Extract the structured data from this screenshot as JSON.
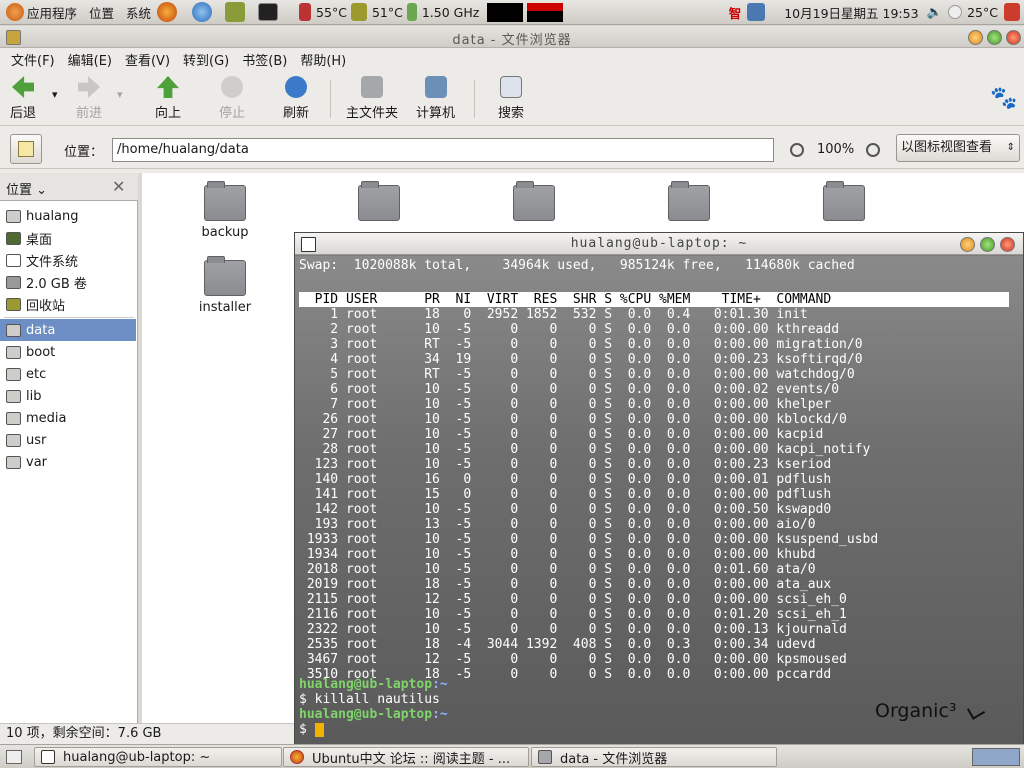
{
  "top_panel": {
    "apps_menu": "应用程序",
    "places_menu": "位置",
    "system_menu": "系统",
    "cpu_temp1": "55°C",
    "cpu_temp2": "51°C",
    "cpu_freq": "1.50 GHz",
    "clock": "10月19日星期五  19:53",
    "weather": "25°C",
    "input_method": "智"
  },
  "nautilus": {
    "title": "data - 文件浏览器",
    "menu": [
      "文件(F)",
      "编辑(E)",
      "查看(V)",
      "转到(G)",
      "书签(B)",
      "帮助(H)"
    ],
    "toolbar": {
      "back": "后退",
      "forward": "前进",
      "up": "向上",
      "stop": "停止",
      "refresh": "刷新",
      "home": "主文件夹",
      "computer": "计算机",
      "search": "搜索"
    },
    "location_label": "位置：",
    "location_path": "/home/hualang/data",
    "zoom": "100%",
    "view_mode": "以图标视图查看",
    "sidebar_title": "位置",
    "sidebar_items": [
      {
        "label": "hualang"
      },
      {
        "label": "桌面"
      },
      {
        "label": "文件系统"
      },
      {
        "label": "2.0 GB 卷"
      },
      {
        "label": "回收站"
      },
      {
        "label": "data"
      },
      {
        "label": "boot"
      },
      {
        "label": "etc"
      },
      {
        "label": "lib"
      },
      {
        "label": "media"
      },
      {
        "label": "usr"
      },
      {
        "label": "var"
      }
    ],
    "files": [
      {
        "label": "backup"
      },
      {
        "label": ""
      },
      {
        "label": ""
      },
      {
        "label": ""
      },
      {
        "label": ""
      },
      {
        "label": "installer"
      }
    ],
    "status": "10 项，剩余空间：7.6 GB"
  },
  "terminal": {
    "title": "hualang@ub-laptop: ~",
    "swap_line": "Swap:  1020088k total,    34964k used,   985124k free,   114680k cached",
    "header": "  PID USER      PR  NI  VIRT  RES  SHR S %CPU %MEM    TIME+  COMMAND",
    "rows": [
      "    1 root      18   0  2952 1852  532 S  0.0  0.4   0:01.30 init",
      "    2 root      10  -5     0    0    0 S  0.0  0.0   0:00.00 kthreadd",
      "    3 root      RT  -5     0    0    0 S  0.0  0.0   0:00.00 migration/0",
      "    4 root      34  19     0    0    0 S  0.0  0.0   0:00.23 ksoftirqd/0",
      "    5 root      RT  -5     0    0    0 S  0.0  0.0   0:00.00 watchdog/0",
      "    6 root      10  -5     0    0    0 S  0.0  0.0   0:00.02 events/0",
      "    7 root      10  -5     0    0    0 S  0.0  0.0   0:00.00 khelper",
      "   26 root      10  -5     0    0    0 S  0.0  0.0   0:00.00 kblockd/0",
      "   27 root      10  -5     0    0    0 S  0.0  0.0   0:00.00 kacpid",
      "   28 root      10  -5     0    0    0 S  0.0  0.0   0:00.00 kacpi_notify",
      "  123 root      10  -5     0    0    0 S  0.0  0.0   0:00.23 kseriod",
      "  140 root      16   0     0    0    0 S  0.0  0.0   0:00.01 pdflush",
      "  141 root      15   0     0    0    0 S  0.0  0.0   0:00.00 pdflush",
      "  142 root      10  -5     0    0    0 S  0.0  0.0   0:00.50 kswapd0",
      "  193 root      13  -5     0    0    0 S  0.0  0.0   0:00.00 aio/0",
      " 1933 root      10  -5     0    0    0 S  0.0  0.0   0:00.00 ksuspend_usbd",
      " 1934 root      10  -5     0    0    0 S  0.0  0.0   0:00.00 khubd",
      " 2018 root      10  -5     0    0    0 S  0.0  0.0   0:01.60 ata/0",
      " 2019 root      18  -5     0    0    0 S  0.0  0.0   0:00.00 ata_aux",
      " 2115 root      12  -5     0    0    0 S  0.0  0.0   0:00.00 scsi_eh_0",
      " 2116 root      10  -5     0    0    0 S  0.0  0.0   0:01.20 scsi_eh_1",
      " 2322 root      10  -5     0    0    0 S  0.0  0.0   0:00.13 kjournald",
      " 2535 root      18  -4  3044 1392  408 S  0.0  0.3   0:00.34 udevd",
      " 3467 root      12  -5     0    0    0 S  0.0  0.0   0:00.00 kpsmoused",
      " 3510 root      18  -5     0    0    0 S  0.0  0.0   0:00.00 pccardd"
    ],
    "prompt_user": "hualang@ub-laptop",
    "prompt_path": ":~",
    "command1": "$ killall nautilus",
    "prompt_symbol": "$ ",
    "logo": "Organic³"
  },
  "taskbar": {
    "tasks": [
      {
        "label": "hualang@ub-laptop: ~"
      },
      {
        "label": "Ubuntu中文 论坛 :: 阅读主题 - ..."
      },
      {
        "label": "data - 文件浏览器"
      }
    ]
  },
  "colors": {
    "selection": "#6d8fc5",
    "prompt_green": "#7fd46a",
    "prompt_blue": "#8fb3ff",
    "cursor": "#f2b300"
  }
}
